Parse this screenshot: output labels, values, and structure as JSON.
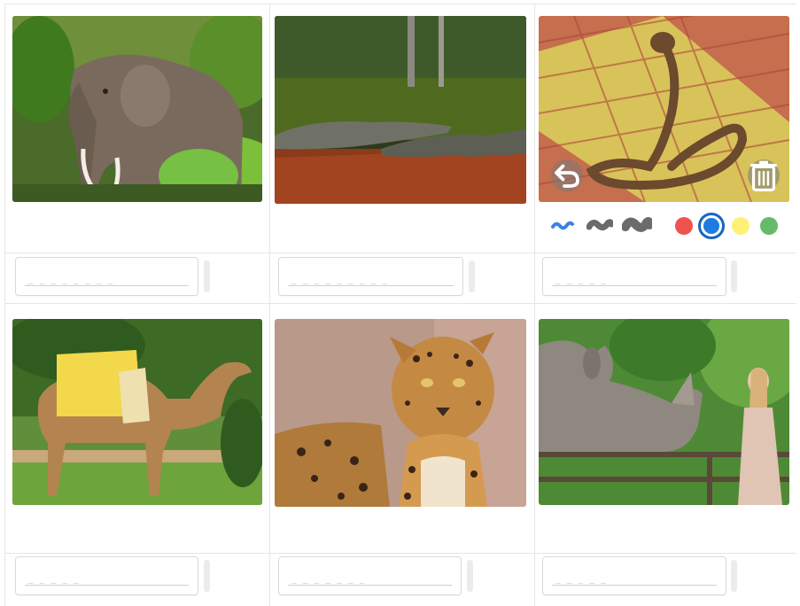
{
  "cards": [
    {
      "animal": "elephant",
      "answer_mask": "_ _ _ _ _ _ _ _"
    },
    {
      "animal": "crocodile",
      "answer_mask": "_ _ _ _ _ _ _ _ _"
    },
    {
      "animal": "cobra",
      "answer_mask": "_ _ _ _ _"
    },
    {
      "animal": "camel",
      "answer_mask": "_ _ _ _ _"
    },
    {
      "animal": "leopard",
      "answer_mask": "_ _ _ _ _ _ _"
    },
    {
      "animal": "rhinoceros",
      "answer_mask": "_ _ _ _ _"
    }
  ],
  "toolbar": {
    "undo_icon": "undo-icon",
    "delete_icon": "trash-icon",
    "brushes": [
      "thin-brush",
      "medium-brush",
      "thick-brush"
    ],
    "colors": [
      "#ef5350",
      "#1e7be0",
      "#fff176",
      "#66bb6a"
    ],
    "selected_color": "#1e7be0"
  }
}
